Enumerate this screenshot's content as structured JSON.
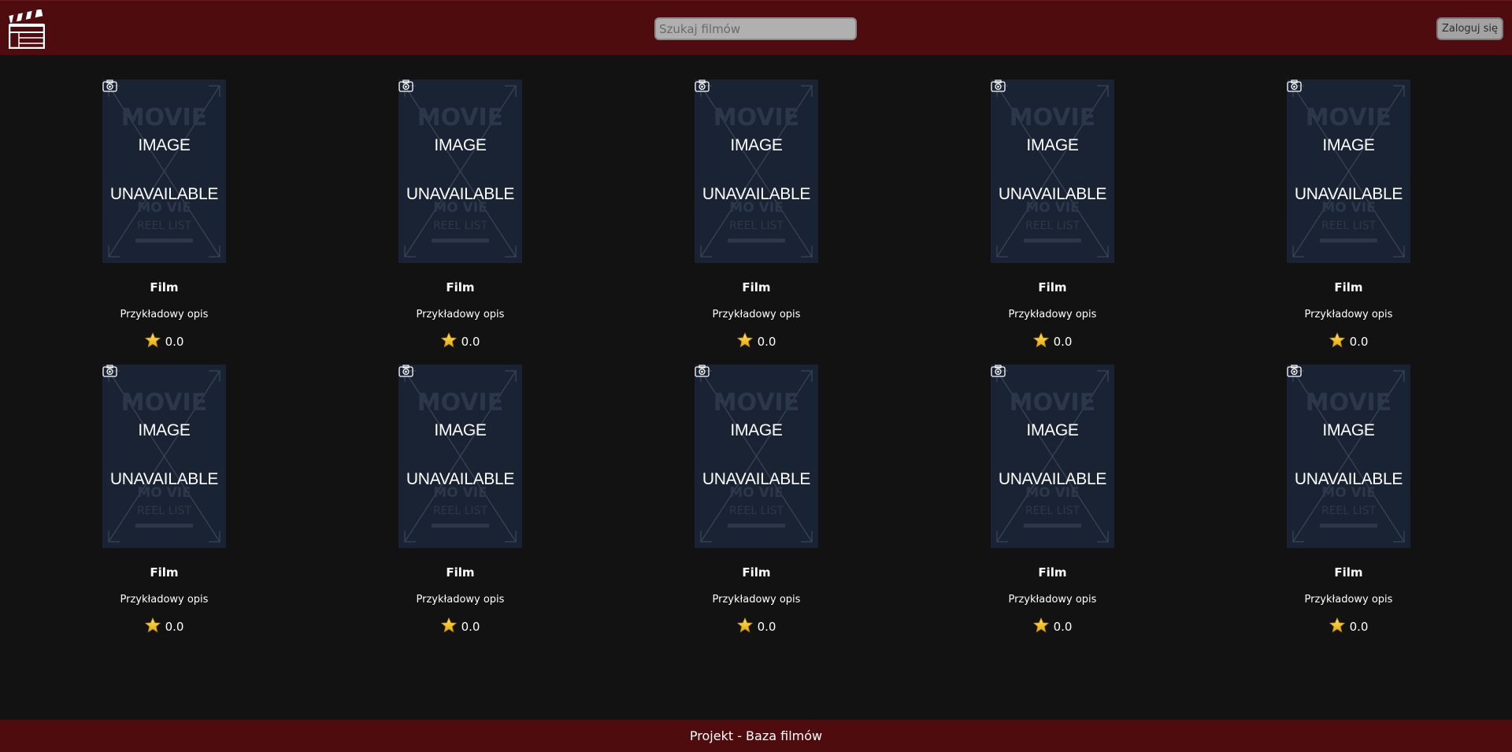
{
  "header": {
    "logo_icon": "clapperboard-icon",
    "search": {
      "placeholder": "Szukaj filmów",
      "value": ""
    },
    "login_label": "Zaloguj się"
  },
  "movies": [
    {
      "poster_line_1": "IMAGE",
      "poster_line_2": "UNAVAILABLE",
      "title": "Film",
      "description": "Przykładowy opis",
      "rating": "0.0"
    },
    {
      "poster_line_1": "IMAGE",
      "poster_line_2": "UNAVAILABLE",
      "title": "Film",
      "description": "Przykładowy opis",
      "rating": "0.0"
    },
    {
      "poster_line_1": "IMAGE",
      "poster_line_2": "UNAVAILABLE",
      "title": "Film",
      "description": "Przykładowy opis",
      "rating": "0.0"
    },
    {
      "poster_line_1": "IMAGE",
      "poster_line_2": "UNAVAILABLE",
      "title": "Film",
      "description": "Przykładowy opis",
      "rating": "0.0"
    },
    {
      "poster_line_1": "IMAGE",
      "poster_line_2": "UNAVAILABLE",
      "title": "Film",
      "description": "Przykładowy opis",
      "rating": "0.0"
    },
    {
      "poster_line_1": "IMAGE",
      "poster_line_2": "UNAVAILABLE",
      "title": "Film",
      "description": "Przykładowy opis",
      "rating": "0.0"
    },
    {
      "poster_line_1": "IMAGE",
      "poster_line_2": "UNAVAILABLE",
      "title": "Film",
      "description": "Przykładowy opis",
      "rating": "0.0"
    },
    {
      "poster_line_1": "IMAGE",
      "poster_line_2": "UNAVAILABLE",
      "title": "Film",
      "description": "Przykładowy opis",
      "rating": "0.0"
    },
    {
      "poster_line_1": "IMAGE",
      "poster_line_2": "UNAVAILABLE",
      "title": "Film",
      "description": "Przykładowy opis",
      "rating": "0.0"
    },
    {
      "poster_line_1": "IMAGE",
      "poster_line_2": "UNAVAILABLE",
      "title": "Film",
      "description": "Przykładowy opis",
      "rating": "0.0"
    }
  ],
  "footer": {
    "text": "Projekt - Baza filmów"
  },
  "colors": {
    "header_bg": "#4e0c0e",
    "page_bg": "#121212",
    "poster_bg": "#1a2333",
    "star": "#f2c419"
  }
}
